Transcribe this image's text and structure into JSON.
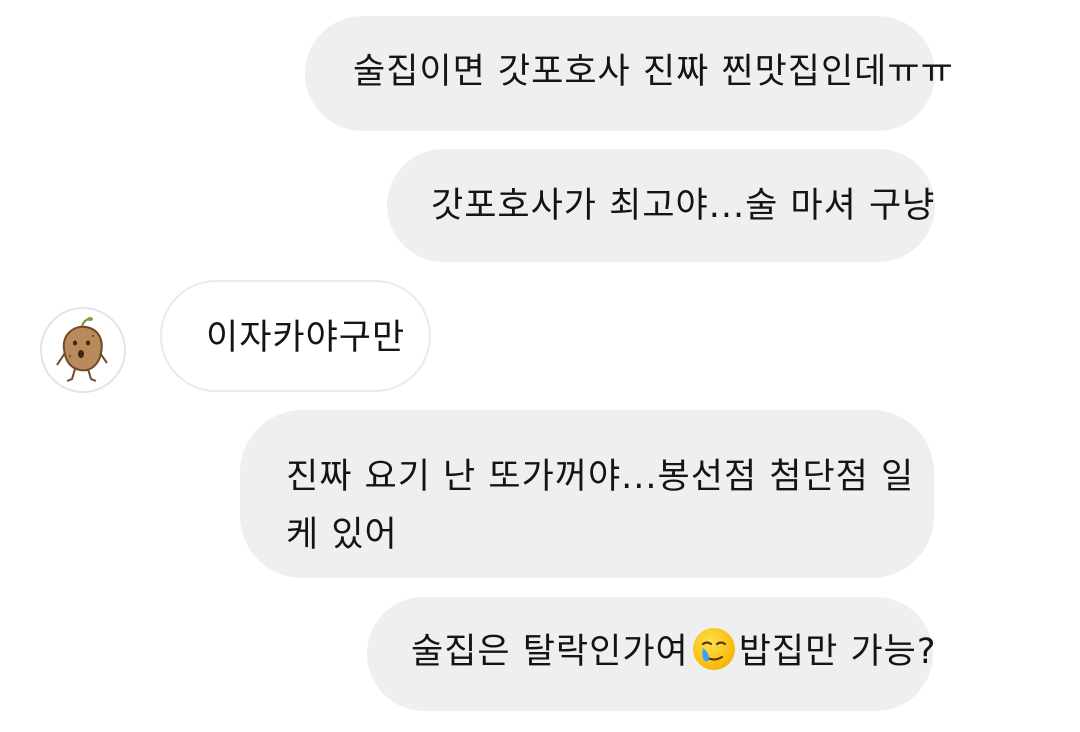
{
  "messages": [
    {
      "sender": "me",
      "text": "술집이면 갓포호사 진짜 찐맛집인데ㅠㅠ"
    },
    {
      "sender": "me",
      "text": "갓포호사가  최고야...술 마셔 구냥"
    },
    {
      "sender": "other",
      "text": "이자카야구만"
    },
    {
      "sender": "me",
      "text": "진짜 요기 난 또가꺼야...봉선점 첨단점 일케 있어"
    },
    {
      "sender": "me",
      "text_before_emoji": "술집은 탈락인가여",
      "emoji": "face-holding-back-tears",
      "text_after_emoji": "밥집만 가능?"
    }
  ],
  "avatar": {
    "icon": "potato-character-icon"
  },
  "colors": {
    "outgoing_bubble": "#efefef",
    "incoming_bubble_border": "#ebebeb",
    "text": "#141414",
    "background": "#ffffff"
  }
}
